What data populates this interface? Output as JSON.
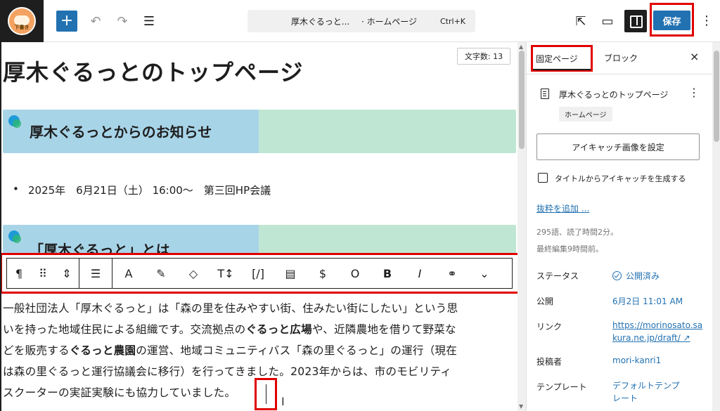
{
  "topbar": {
    "logo_text": "下書き",
    "add_label": "+",
    "undo_icon": "undo-icon",
    "redo_icon": "redo-icon",
    "outline_icon": "list-view-icon",
    "doc_title": "厚木ぐるっと...",
    "doc_type": "· ホームページ",
    "shortcut": "Ctrl+K",
    "save_label": "保存"
  },
  "editor": {
    "word_count": "文字数: 13",
    "page_title": "厚木ぐるっとのトップページ",
    "heading1": "厚木ぐるっとからのお知らせ",
    "bullet": "2025年　6月21日（土） 16:00～　第三回HP会議",
    "heading2": "「厚木ぐるっと」とは",
    "toolbar": [
      "¶",
      "⠿",
      "⇕",
      "☰",
      "A",
      "✎",
      "◇",
      "T↕",
      "[/]",
      "▤",
      "$",
      "O",
      "B",
      "I",
      "⚭",
      "⌄"
    ],
    "body_line1": "一般社団法人「厚木ぐるっと」は「森の里を住みやすい街、住みたい街にしたい」という思",
    "body_line2a": "いを持った地域住民による組織です。交流拠点の",
    "body_line2b": "ぐるっと広場",
    "body_line2c": "や、近隣農地を借りて野菜な",
    "body_line3a": "どを販売する",
    "body_line3b": "ぐるっと農園",
    "body_line3c": "の運営、地域コミュニティバス「森の里ぐるっと」の運行（現在",
    "body_line4": "は森の里ぐるっと運行協議会に移行）を行ってきました。2023年からは、市のモビリティ",
    "body_line5": "スクーターの実証実験にも協力していました。"
  },
  "sidebar": {
    "tab_page": "固定ページ",
    "tab_block": "ブロック",
    "close": "×",
    "doc_title": "厚木ぐるっとのトップページ",
    "badge": "ホームページ",
    "featured_button": "アイキャッチ画像を設定",
    "auto_featured": "タイトルからアイキャッチを生成する",
    "excerpt": "抜粋を追加 ...",
    "meta_words": "295語、読了時間2分。",
    "meta_edited": "最終編集9時間前。",
    "status_label": "ステータス",
    "status_value": "公開済み",
    "publish_label": "公開",
    "publish_value": "6月2日 11:01 AM",
    "link_label": "リンク",
    "link_value_1": "https://morinosato.sa",
    "link_value_2": "kura.ne.jp/draft/ ↗",
    "author_label": "投稿者",
    "author_value": "mori-kanri1",
    "template_label": "テンプレート",
    "template_value_1": "デフォルトテンプ",
    "template_value_2": "レート"
  }
}
